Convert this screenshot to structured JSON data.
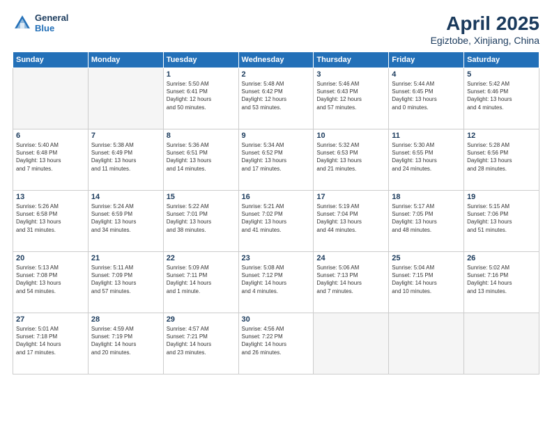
{
  "header": {
    "logo_line1": "General",
    "logo_line2": "Blue",
    "title": "April 2025",
    "subtitle": "Egiztobe, Xinjiang, China"
  },
  "days_of_week": [
    "Sunday",
    "Monday",
    "Tuesday",
    "Wednesday",
    "Thursday",
    "Friday",
    "Saturday"
  ],
  "weeks": [
    [
      {
        "num": "",
        "info": ""
      },
      {
        "num": "",
        "info": ""
      },
      {
        "num": "1",
        "info": "Sunrise: 5:50 AM\nSunset: 6:41 PM\nDaylight: 12 hours\nand 50 minutes."
      },
      {
        "num": "2",
        "info": "Sunrise: 5:48 AM\nSunset: 6:42 PM\nDaylight: 12 hours\nand 53 minutes."
      },
      {
        "num": "3",
        "info": "Sunrise: 5:46 AM\nSunset: 6:43 PM\nDaylight: 12 hours\nand 57 minutes."
      },
      {
        "num": "4",
        "info": "Sunrise: 5:44 AM\nSunset: 6:45 PM\nDaylight: 13 hours\nand 0 minutes."
      },
      {
        "num": "5",
        "info": "Sunrise: 5:42 AM\nSunset: 6:46 PM\nDaylight: 13 hours\nand 4 minutes."
      }
    ],
    [
      {
        "num": "6",
        "info": "Sunrise: 5:40 AM\nSunset: 6:48 PM\nDaylight: 13 hours\nand 7 minutes."
      },
      {
        "num": "7",
        "info": "Sunrise: 5:38 AM\nSunset: 6:49 PM\nDaylight: 13 hours\nand 11 minutes."
      },
      {
        "num": "8",
        "info": "Sunrise: 5:36 AM\nSunset: 6:51 PM\nDaylight: 13 hours\nand 14 minutes."
      },
      {
        "num": "9",
        "info": "Sunrise: 5:34 AM\nSunset: 6:52 PM\nDaylight: 13 hours\nand 17 minutes."
      },
      {
        "num": "10",
        "info": "Sunrise: 5:32 AM\nSunset: 6:53 PM\nDaylight: 13 hours\nand 21 minutes."
      },
      {
        "num": "11",
        "info": "Sunrise: 5:30 AM\nSunset: 6:55 PM\nDaylight: 13 hours\nand 24 minutes."
      },
      {
        "num": "12",
        "info": "Sunrise: 5:28 AM\nSunset: 6:56 PM\nDaylight: 13 hours\nand 28 minutes."
      }
    ],
    [
      {
        "num": "13",
        "info": "Sunrise: 5:26 AM\nSunset: 6:58 PM\nDaylight: 13 hours\nand 31 minutes."
      },
      {
        "num": "14",
        "info": "Sunrise: 5:24 AM\nSunset: 6:59 PM\nDaylight: 13 hours\nand 34 minutes."
      },
      {
        "num": "15",
        "info": "Sunrise: 5:22 AM\nSunset: 7:01 PM\nDaylight: 13 hours\nand 38 minutes."
      },
      {
        "num": "16",
        "info": "Sunrise: 5:21 AM\nSunset: 7:02 PM\nDaylight: 13 hours\nand 41 minutes."
      },
      {
        "num": "17",
        "info": "Sunrise: 5:19 AM\nSunset: 7:04 PM\nDaylight: 13 hours\nand 44 minutes."
      },
      {
        "num": "18",
        "info": "Sunrise: 5:17 AM\nSunset: 7:05 PM\nDaylight: 13 hours\nand 48 minutes."
      },
      {
        "num": "19",
        "info": "Sunrise: 5:15 AM\nSunset: 7:06 PM\nDaylight: 13 hours\nand 51 minutes."
      }
    ],
    [
      {
        "num": "20",
        "info": "Sunrise: 5:13 AM\nSunset: 7:08 PM\nDaylight: 13 hours\nand 54 minutes."
      },
      {
        "num": "21",
        "info": "Sunrise: 5:11 AM\nSunset: 7:09 PM\nDaylight: 13 hours\nand 57 minutes."
      },
      {
        "num": "22",
        "info": "Sunrise: 5:09 AM\nSunset: 7:11 PM\nDaylight: 14 hours\nand 1 minute."
      },
      {
        "num": "23",
        "info": "Sunrise: 5:08 AM\nSunset: 7:12 PM\nDaylight: 14 hours\nand 4 minutes."
      },
      {
        "num": "24",
        "info": "Sunrise: 5:06 AM\nSunset: 7:13 PM\nDaylight: 14 hours\nand 7 minutes."
      },
      {
        "num": "25",
        "info": "Sunrise: 5:04 AM\nSunset: 7:15 PM\nDaylight: 14 hours\nand 10 minutes."
      },
      {
        "num": "26",
        "info": "Sunrise: 5:02 AM\nSunset: 7:16 PM\nDaylight: 14 hours\nand 13 minutes."
      }
    ],
    [
      {
        "num": "27",
        "info": "Sunrise: 5:01 AM\nSunset: 7:18 PM\nDaylight: 14 hours\nand 17 minutes."
      },
      {
        "num": "28",
        "info": "Sunrise: 4:59 AM\nSunset: 7:19 PM\nDaylight: 14 hours\nand 20 minutes."
      },
      {
        "num": "29",
        "info": "Sunrise: 4:57 AM\nSunset: 7:21 PM\nDaylight: 14 hours\nand 23 minutes."
      },
      {
        "num": "30",
        "info": "Sunrise: 4:56 AM\nSunset: 7:22 PM\nDaylight: 14 hours\nand 26 minutes."
      },
      {
        "num": "",
        "info": ""
      },
      {
        "num": "",
        "info": ""
      },
      {
        "num": "",
        "info": ""
      }
    ]
  ]
}
